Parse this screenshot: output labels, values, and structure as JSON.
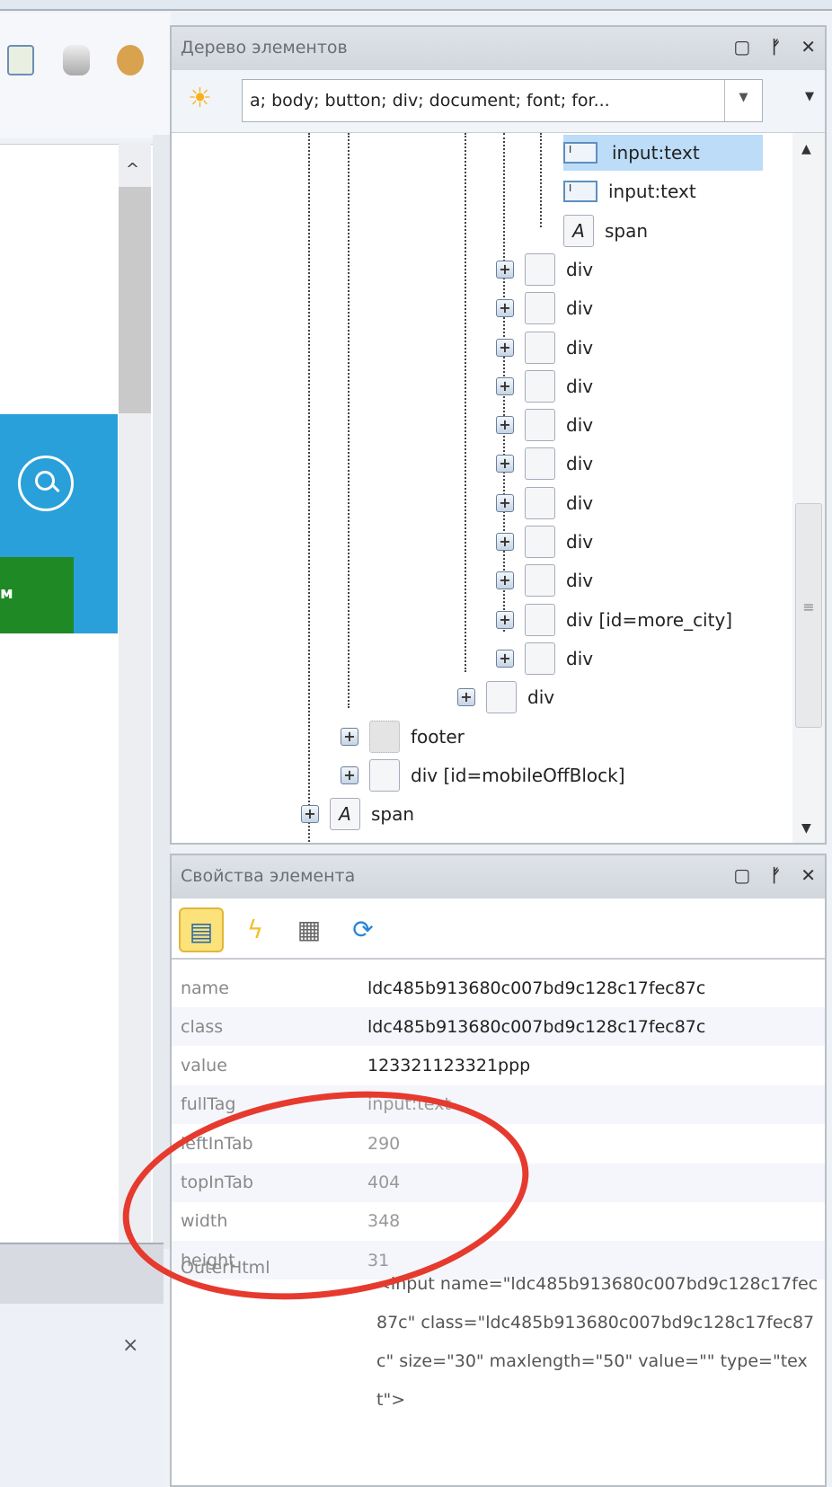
{
  "tree_panel": {
    "title": "Дерево элементов",
    "filter_value": "a; body; button; div; document; font; for...",
    "nodes": [
      {
        "label": "input:text",
        "icon": "input-icon",
        "selected": true
      },
      {
        "label": "input:text",
        "icon": "input-icon"
      },
      {
        "label": "span",
        "icon": "text-icon"
      },
      {
        "label": "div"
      },
      {
        "label": "div"
      },
      {
        "label": "div"
      },
      {
        "label": "div"
      },
      {
        "label": "div"
      },
      {
        "label": "div"
      },
      {
        "label": "div"
      },
      {
        "label": "div"
      },
      {
        "label": "div"
      },
      {
        "label": "div [id=more_city]"
      },
      {
        "label": "div"
      },
      {
        "label": "div"
      },
      {
        "label": "footer"
      },
      {
        "label": "div [id=mobileOffBlock]"
      },
      {
        "label": "span"
      }
    ]
  },
  "props_panel": {
    "title": "Свойства элемента",
    "rows": [
      {
        "key": "name",
        "value": "ldc485b913680c007bd9c128c17fec87c"
      },
      {
        "key": "class",
        "value": "ldc485b913680c007bd9c128c17fec87c"
      },
      {
        "key": "value",
        "value": "123321123321ppp"
      },
      {
        "key": "fullTag",
        "value": "input:text"
      },
      {
        "key": "leftInTab",
        "value": "290"
      },
      {
        "key": "topInTab",
        "value": "404"
      },
      {
        "key": "width",
        "value": "348"
      },
      {
        "key": "height",
        "value": "31"
      }
    ],
    "outer_key": "OuterHtml",
    "outer_value": "<input name=\"ldc485b913680c007bd9c128c17fec87c\" class=\"ldc485b913680c007bd9c128c17fec87c\" size=\"30\" maxlength=\"50\" value=\"\" type=\"text\">"
  },
  "browser": {
    "green_button_label": "м"
  },
  "colors": {
    "banner": "#29a0da",
    "green": "#1f8a25",
    "selection": "#bcdcf7",
    "annotation": "#e63a2e"
  }
}
